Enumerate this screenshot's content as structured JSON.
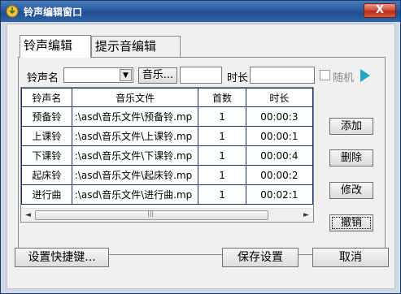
{
  "window": {
    "title": "铃声编辑窗口",
    "close_label": "X"
  },
  "tabs": [
    {
      "label": "铃声编辑",
      "active": true
    },
    {
      "label": "提示音编辑",
      "active": false
    }
  ],
  "form": {
    "ring_name_label": "铃声名",
    "ring_name_value": "",
    "music_button": "音乐...",
    "music_value": "",
    "duration_label": "时长",
    "duration_value": "",
    "random_label": "随机",
    "random_checked": false,
    "play_icon": "play-icon"
  },
  "table": {
    "columns": [
      "铃声名",
      "音乐文件",
      "首数",
      "时长"
    ],
    "rows": [
      {
        "name": "预备铃",
        "file": ":\\asd\\音乐文件\\预备铃.mp",
        "count": "1",
        "duration": "00:00:3"
      },
      {
        "name": "上课铃",
        "file": ":\\asd\\音乐文件\\上课铃.mp",
        "count": "1",
        "duration": "00:00:1"
      },
      {
        "name": "下课铃",
        "file": ":\\asd\\音乐文件\\下课铃.mp",
        "count": "1",
        "duration": "00:00:4"
      },
      {
        "name": "起床铃",
        "file": ":\\asd\\音乐文件\\起床铃.mp",
        "count": "1",
        "duration": "00:00:2"
      },
      {
        "name": "进行曲",
        "file": ":\\asd\\音乐文件\\进行曲.mp",
        "count": "1",
        "duration": "00:02:1"
      }
    ],
    "scroll_left_icon": "◄",
    "scroll_right_icon": "►",
    "scroll_grip": "|||"
  },
  "side_buttons": {
    "add": "添加",
    "delete": "删除",
    "modify": "修改",
    "cancel": "撤销"
  },
  "bottom": {
    "shortcut": "设置快捷键...",
    "save": "保存设置",
    "cancel": "取消"
  },
  "colors": {
    "title_bar": "#2a5a9c",
    "close_button": "#c4442a",
    "grid_line": "#1f2a6e",
    "play_icon": "#22a6c6"
  }
}
